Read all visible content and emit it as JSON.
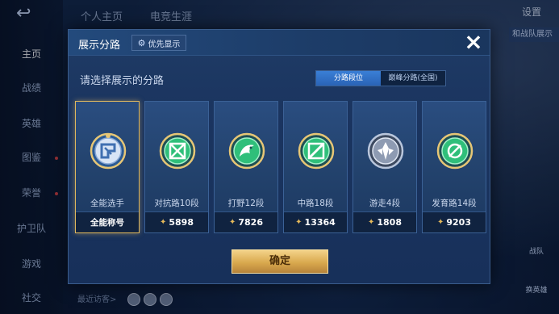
{
  "background": {
    "nav_items": [
      {
        "label": "主页",
        "active": true
      },
      {
        "label": "战绩",
        "active": false
      },
      {
        "label": "英雄",
        "active": false
      },
      {
        "label": "图鉴",
        "active": false
      },
      {
        "label": "荣誉",
        "active": false
      },
      {
        "label": "护卫队",
        "active": false
      },
      {
        "label": "游戏",
        "active": false
      },
      {
        "label": "社交",
        "active": false
      }
    ],
    "top_tabs": [
      "个人主页",
      "电竞生涯"
    ],
    "settings_label": "设置",
    "chip_label": "和战队展示",
    "visitors_label": "最近访客>",
    "right_btn_1": "战队",
    "right_btn_2": "换英雄"
  },
  "modal": {
    "title": "展示分路",
    "priority_label": "优先显示",
    "close_icon": "×",
    "subtitle": "请选择展示的分路",
    "segments": [
      {
        "label": "分路段位",
        "active": true
      },
      {
        "label": "巅峰分路(全国)",
        "active": false
      }
    ],
    "cards": [
      {
        "name": "全能选手",
        "bar_text": "全能称号",
        "value": null,
        "selected": true,
        "icon": "allround-emblem-icon"
      },
      {
        "name": "对抗路10段",
        "bar_text": null,
        "value": "5898",
        "selected": false,
        "icon": "clash-lane-emblem-icon"
      },
      {
        "name": "打野12段",
        "bar_text": null,
        "value": "7826",
        "selected": false,
        "icon": "jungle-emblem-icon"
      },
      {
        "name": "中路18段",
        "bar_text": null,
        "value": "13364",
        "selected": false,
        "icon": "mid-lane-emblem-icon"
      },
      {
        "name": "游走4段",
        "bar_text": null,
        "value": "1808",
        "selected": false,
        "icon": "roam-emblem-icon"
      },
      {
        "name": "发育路14段",
        "bar_text": null,
        "value": "9203",
        "selected": false,
        "icon": "farm-lane-emblem-icon"
      }
    ],
    "confirm_label": "确定"
  },
  "colors": {
    "accent_gold": "#e0b85e",
    "emblem_green": "#2fbf7a",
    "segment_active": "#3a7fd6"
  }
}
